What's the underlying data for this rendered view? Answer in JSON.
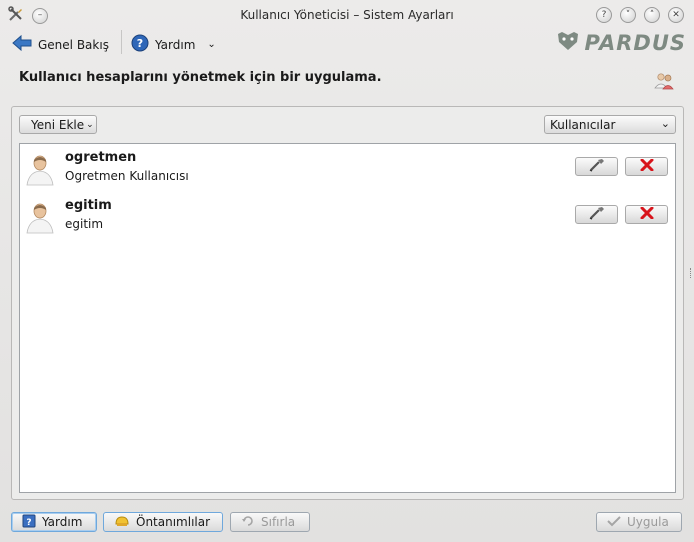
{
  "window": {
    "title": "Kullanıcı Yöneticisi – Sistem Ayarları"
  },
  "toolbar": {
    "back_label": "Genel Bakış",
    "help_label": "Yardım"
  },
  "brand": {
    "logo_text": "PARDUS"
  },
  "header": {
    "description": "Kullanıcı hesaplarını yönetmek için bir uygulama."
  },
  "controls": {
    "add_new_label": "Yeni Ekle",
    "filter_selected": "Kullanıcılar"
  },
  "users": [
    {
      "username": "ogretmen",
      "fullname": "Ogretmen Kullanıcısı"
    },
    {
      "username": "egitim",
      "fullname": "egitim"
    }
  ],
  "footer": {
    "help_label": "Yardım",
    "defaults_label": "Öntanımlılar",
    "reset_label": "Sıfırla",
    "apply_label": "Uygula"
  },
  "colors": {
    "delete_red": "#d8141b",
    "focus_blue": "#6fa8dc",
    "back_arrow_blue": "#3b78c4"
  }
}
